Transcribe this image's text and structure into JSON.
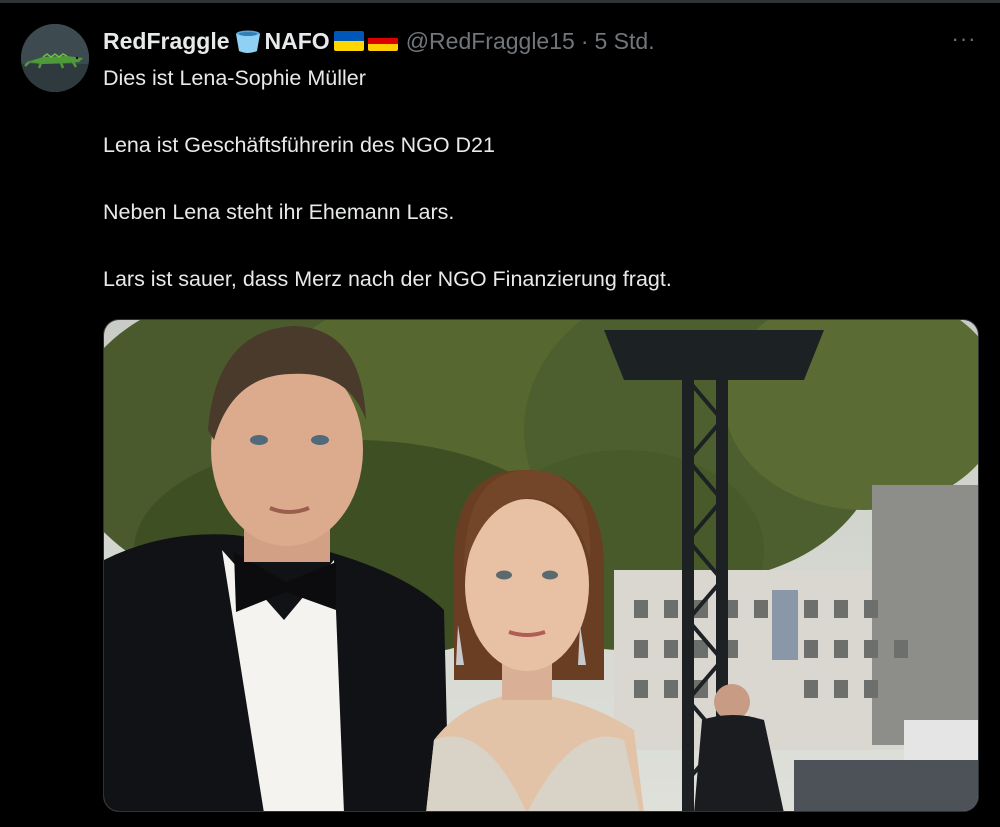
{
  "tweet": {
    "author": {
      "display_name": "RedFraggle",
      "name_suffix": "NAFO",
      "handle": "@RedFraggle15",
      "separator": "·",
      "time_ago": "5 Std."
    },
    "more_label": "···",
    "lines": [
      "Dies ist Lena-Sophie Müller",
      "Lena ist Geschäftsführerin des NGO D21",
      "Neben Lena steht ihr Ehemann Lars.",
      "Lars ist sauer, dass Merz nach der NGO Finanzierung fragt."
    ]
  },
  "icons": {
    "name_emoji": "bucket-icon",
    "flags": [
      "flag-ukraine-icon",
      "flag-germany-icon"
    ],
    "avatar": "crocodile-avatar"
  },
  "colors": {
    "background": "#000000",
    "text_primary": "#e7e9ea",
    "text_secondary": "#71767b",
    "border": "#2f3336",
    "ukraine_blue": "#0057b7",
    "ukraine_yellow": "#ffd700",
    "germany_black": "#000000",
    "germany_red": "#dd0000",
    "germany_gold": "#ffce00"
  }
}
